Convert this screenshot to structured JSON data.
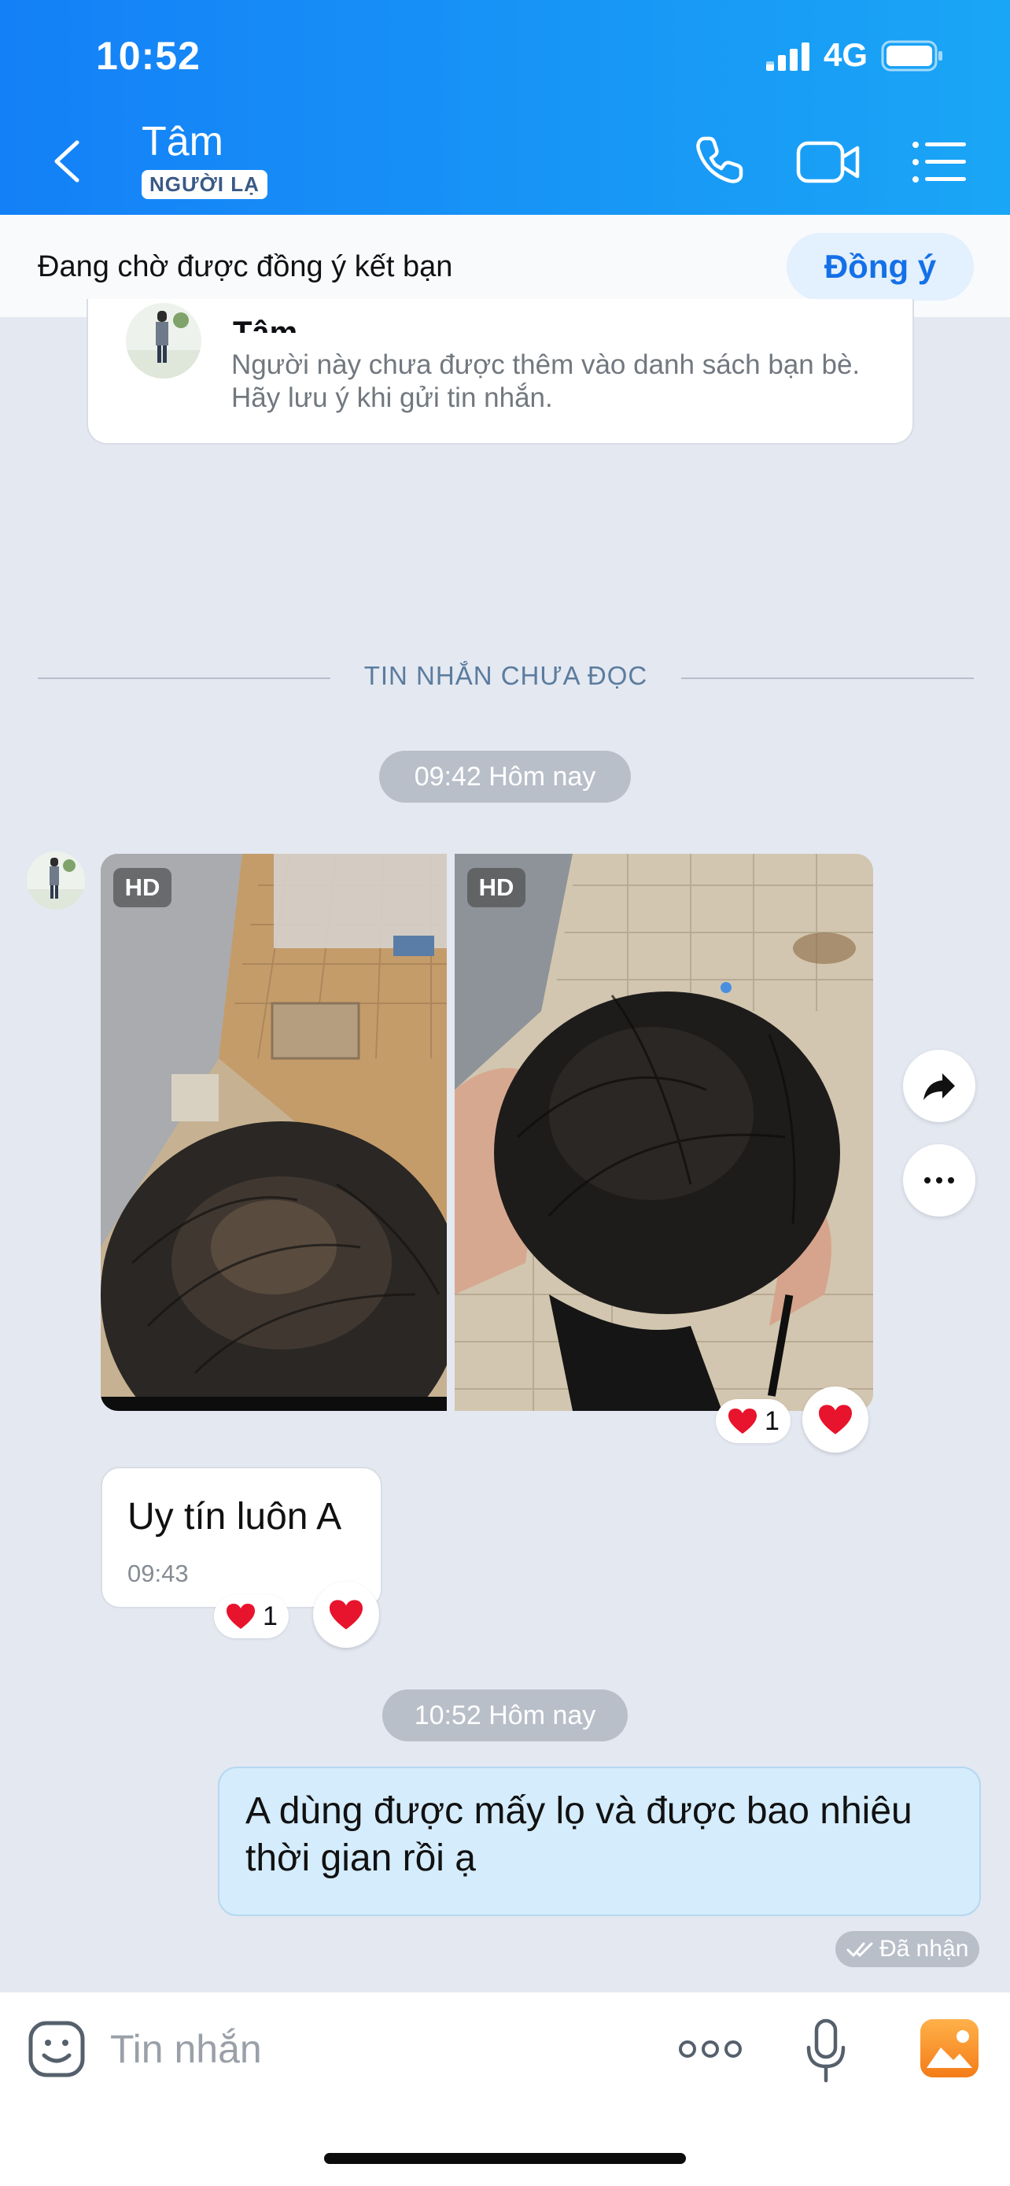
{
  "status_bar": {
    "time": "10:52",
    "network": "4G"
  },
  "header": {
    "contact_name": "Tâm",
    "badge": "NGƯỜI LẠ"
  },
  "friend_request": {
    "text": "Đang chờ được đồng ý kết bạn",
    "accept_label": "Đồng ý"
  },
  "info_card": {
    "name": "Tâm",
    "description": "Người này chưa được thêm vào danh sách bạn bè. Hãy lưu ý khi gửi tin nhắn."
  },
  "unread_divider": "TIN NHẮN CHƯA ĐỌC",
  "messages": {
    "time_pill_1": "09:42 Hôm nay",
    "photo_hd_1": "HD",
    "photo_hd_2": "HD",
    "photo_reaction_count": "1",
    "incoming_text": "Uy tín luôn A",
    "incoming_time": "09:43",
    "text_reaction_count": "1",
    "time_pill_2": "10:52 Hôm nay",
    "outgoing_text": "A dùng được mấy lọ và được bao nhiêu thời gian rồi ạ",
    "outgoing_status": "Đã nhận"
  },
  "input": {
    "placeholder": "Tin nhắn"
  },
  "colors": {
    "header_start": "#1480f7",
    "header_end": "#1aa6f6",
    "accent": "#1470e8",
    "outgoing_bubble": "#d4ecfc",
    "background": "#e4e8f1",
    "reaction": "#e8132c"
  }
}
